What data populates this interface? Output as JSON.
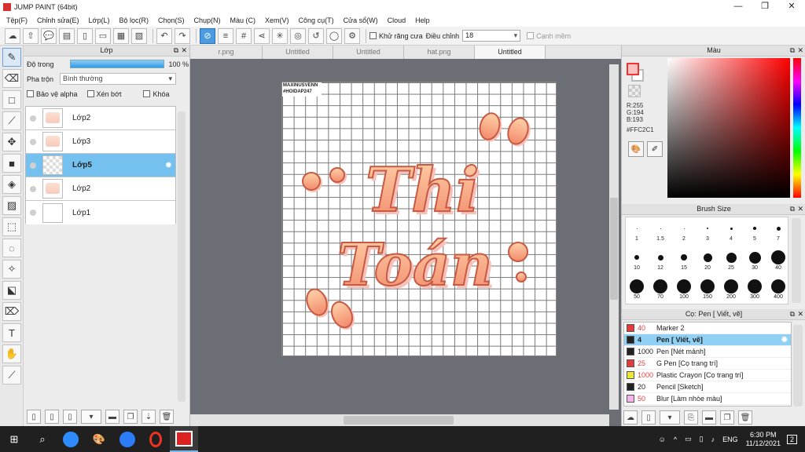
{
  "window": {
    "title": "JUMP PAINT (64bit)",
    "controls": [
      "—",
      "❐",
      "✕"
    ]
  },
  "menu": [
    "Tệp(F)",
    "Chỉnh sửa(E)",
    "Lớp(L)",
    "Bộ lọc(R)",
    "Chọn(S)",
    "Chụp(N)",
    "Màu (C)",
    "Xem(V)",
    "Công cụ(T)",
    "Cửa sổ(W)",
    "Cloud",
    "Help"
  ],
  "toolbar": {
    "antialias_label": "Khử răng cưa",
    "adjust_label": "Điều chỉnh",
    "adjust_value": "18",
    "sharp_label": "Cạnh mềm"
  },
  "layer_panel": {
    "title": "Lớp",
    "opacity_label": "Độ trong",
    "opacity_value": "100 %",
    "opacity_fraction": 1.0,
    "blend_label": "Pha trộn",
    "blend_value": "Bình thường",
    "protect_alpha": "Bảo vệ alpha",
    "clip": "Xén bớt",
    "lock": "Khóa",
    "layers": [
      {
        "name": "Lớp2",
        "active": false
      },
      {
        "name": "Lớp3",
        "active": false
      },
      {
        "name": "Lớp5",
        "active": true
      },
      {
        "name": "Lớp2",
        "active": false
      },
      {
        "name": "Lớp1",
        "active": false
      }
    ]
  },
  "tabs": [
    {
      "label": "r.png",
      "active": false
    },
    {
      "label": "Untitled",
      "active": false
    },
    {
      "label": "Untitled",
      "active": false
    },
    {
      "label": "hat.png",
      "active": false
    },
    {
      "label": "Untitled",
      "active": true
    }
  ],
  "canvas": {
    "watermark_line1": "MAXINUSVENN",
    "watermark_line2": "#HOIDAP247",
    "artwork_text_1": "Thi",
    "artwork_text_2": "Toán"
  },
  "color_panel": {
    "title": "Màu",
    "r": "R:255",
    "g": "G:194",
    "b": "B:193",
    "hex": "#FFC2C1",
    "accent": "#FFC2C1"
  },
  "brush_size": {
    "title": "Brush Size",
    "sizes": [
      "1",
      "1.5",
      "2",
      "3",
      "4",
      "5",
      "7",
      "10",
      "12",
      "15",
      "20",
      "25",
      "30",
      "40",
      "50",
      "70",
      "100",
      "150",
      "200",
      "300",
      "400"
    ]
  },
  "brush_list": {
    "title": "Cọ: Pen [ Viết, vẽ]",
    "items": [
      {
        "size": "40",
        "name": "Marker 2",
        "color": "#e33b3b"
      },
      {
        "size": "4",
        "name": "Pen [ Viết, vẽ]",
        "color": "#222222",
        "active": true
      },
      {
        "size": "1000",
        "name": "Pen [Nét mảnh]",
        "color": "#222222"
      },
      {
        "size": "25",
        "name": "G Pen [Cọ trang trí]",
        "color": "#e33b3b"
      },
      {
        "size": "1000",
        "name": "Plastic Crayon [Cọ trang trí]",
        "color": "#e8e83a"
      },
      {
        "size": "20",
        "name": "Pencil [Sketch]",
        "color": "#222222"
      },
      {
        "size": "50",
        "name": "Blur [Làm nhòe màu]",
        "color": "#f4b6e8"
      }
    ]
  },
  "taskbar": {
    "lang": "ENG",
    "time": "6:30 PM",
    "date": "11/12/2021",
    "notifications": "2"
  }
}
